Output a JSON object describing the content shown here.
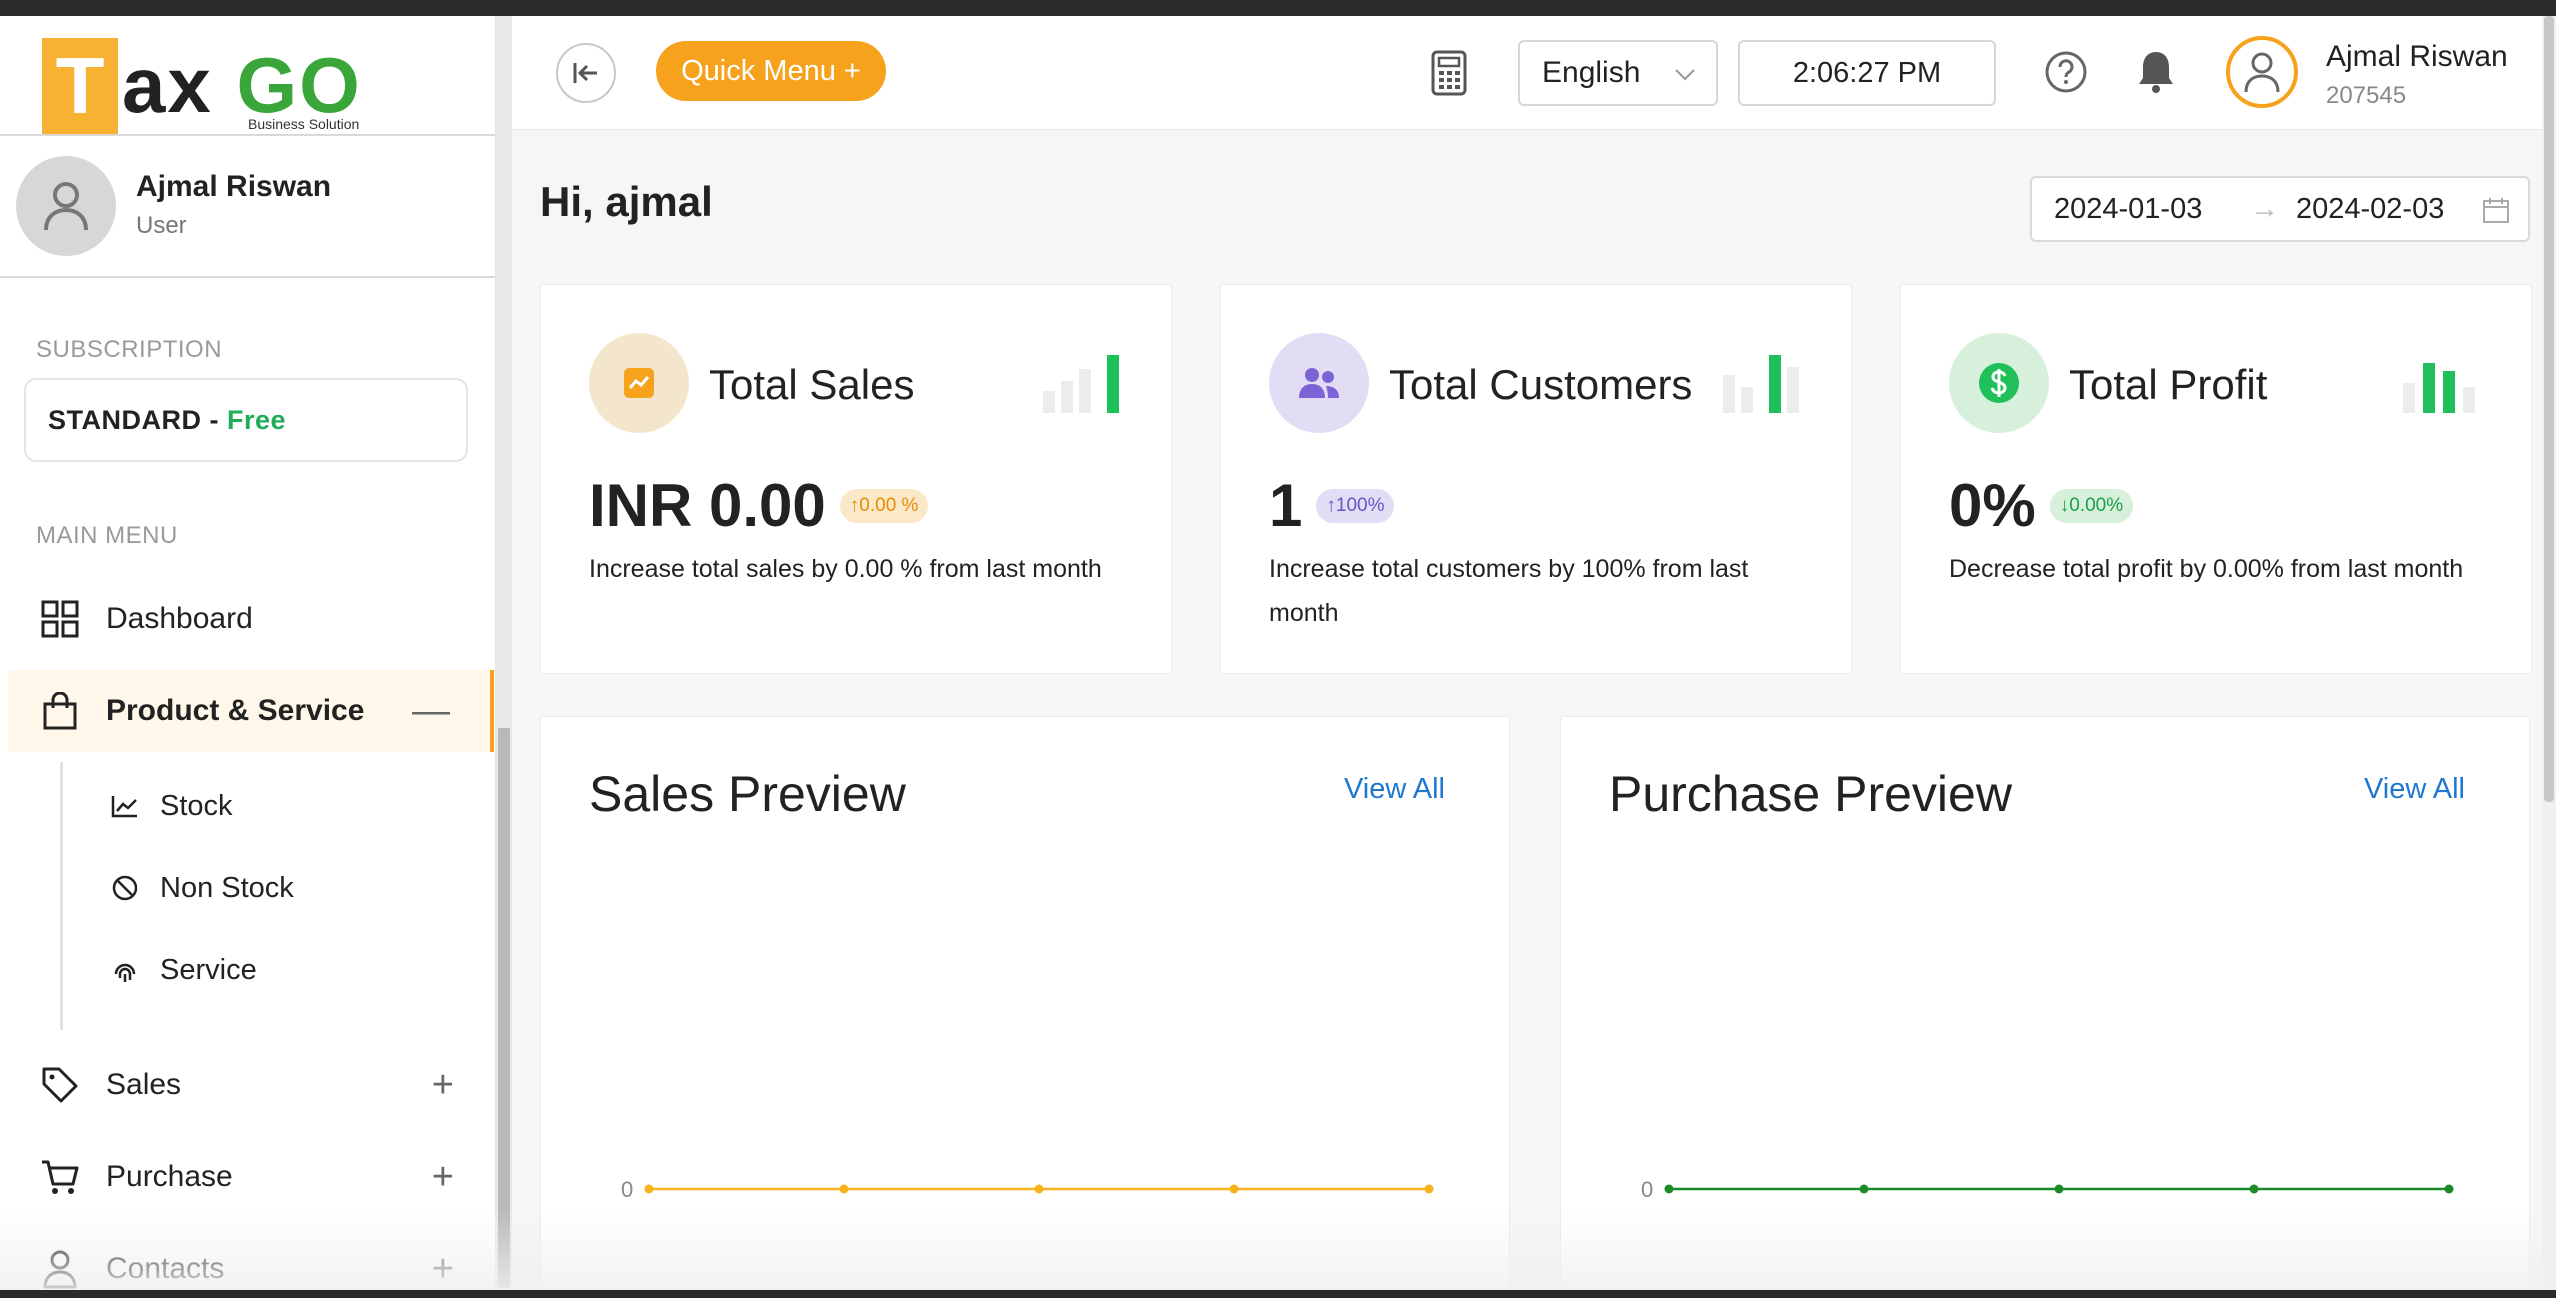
{
  "brand": {
    "logo_letter": "T",
    "logo_text_dark": "ax",
    "logo_text_green": "GO",
    "tagline": "Business Solution",
    "accent_color": "#f7a21c",
    "green_color": "#3aa63a"
  },
  "sidebar": {
    "user_name": "Ajmal Riswan",
    "user_role": "User",
    "subscription_label": "SUBSCRIPTION",
    "plan_name": "STANDARD",
    "plan_sep": "-",
    "plan_tier": "Free",
    "main_menu_label": "MAIN MENU",
    "items": [
      {
        "label": "Dashboard",
        "icon": "grid-icon"
      },
      {
        "label": "Product & Service",
        "icon": "shopping-bag-icon",
        "toggle": "—",
        "expanded": true
      },
      {
        "label": "Sales",
        "icon": "tag-icon",
        "toggle": "+"
      },
      {
        "label": "Purchase",
        "icon": "cart-icon",
        "toggle": "+"
      },
      {
        "label": "Contacts",
        "icon": "user-icon",
        "toggle": "+"
      }
    ],
    "subitems": [
      {
        "label": "Stock",
        "icon": "stock-chart-icon"
      },
      {
        "label": "Non Stock",
        "icon": "stop-icon"
      },
      {
        "label": "Service",
        "icon": "fingerprint-icon"
      }
    ]
  },
  "topbar": {
    "quick_menu_label": "Quick Menu +",
    "language": "English",
    "time": "2:06:27 PM",
    "user_name": "Ajmal Riswan",
    "user_id": "207545"
  },
  "main": {
    "greeting": "Hi, ajmal",
    "date_from": "2024-01-03",
    "date_arrow": "→",
    "date_to": "2024-02-03"
  },
  "stats": [
    {
      "title": "Total Sales",
      "value": "INR 0.00",
      "badge": "↑0.00 %",
      "desc": "Increase total sales by 0.00 % from last month",
      "icon": "chart-icon",
      "icon_bg": "#f3e6cc",
      "icon_color": "#f7a21c",
      "badge_bg": "#fbe8c8",
      "badge_color": "#e88c00",
      "bar_color": "#1fbf5a"
    },
    {
      "title": "Total Customers",
      "value": "1",
      "badge": "↑100%",
      "desc": "Increase total customers by 100% from last month",
      "icon": "users-icon",
      "icon_bg": "#e2dcf5",
      "icon_color": "#7a64d6",
      "badge_bg": "#e2dcf5",
      "badge_color": "#6a55c6",
      "bar_color": "#1fbf5a"
    },
    {
      "title": "Total Profit",
      "value": "0%",
      "badge": "↓0.00%",
      "desc": "Decrease total profit by 0.00% from last month",
      "icon": "dollar-icon",
      "icon_bg": "#d6f0dc",
      "icon_color": "#1fbf5a",
      "badge_bg": "#d6f0dc",
      "badge_color": "#1b9e4a",
      "bar_color": "#1fbf5a"
    }
  ],
  "previews": [
    {
      "title": "Sales Preview",
      "link": "View All",
      "y_label": "0",
      "line_color": "#f7b21c",
      "points": [
        0,
        0,
        0,
        0,
        0
      ]
    },
    {
      "title": "Purchase Preview",
      "link": "View All",
      "y_label": "0",
      "line_color": "#1a8a2a",
      "points": [
        0,
        0,
        0,
        0,
        0
      ]
    }
  ]
}
